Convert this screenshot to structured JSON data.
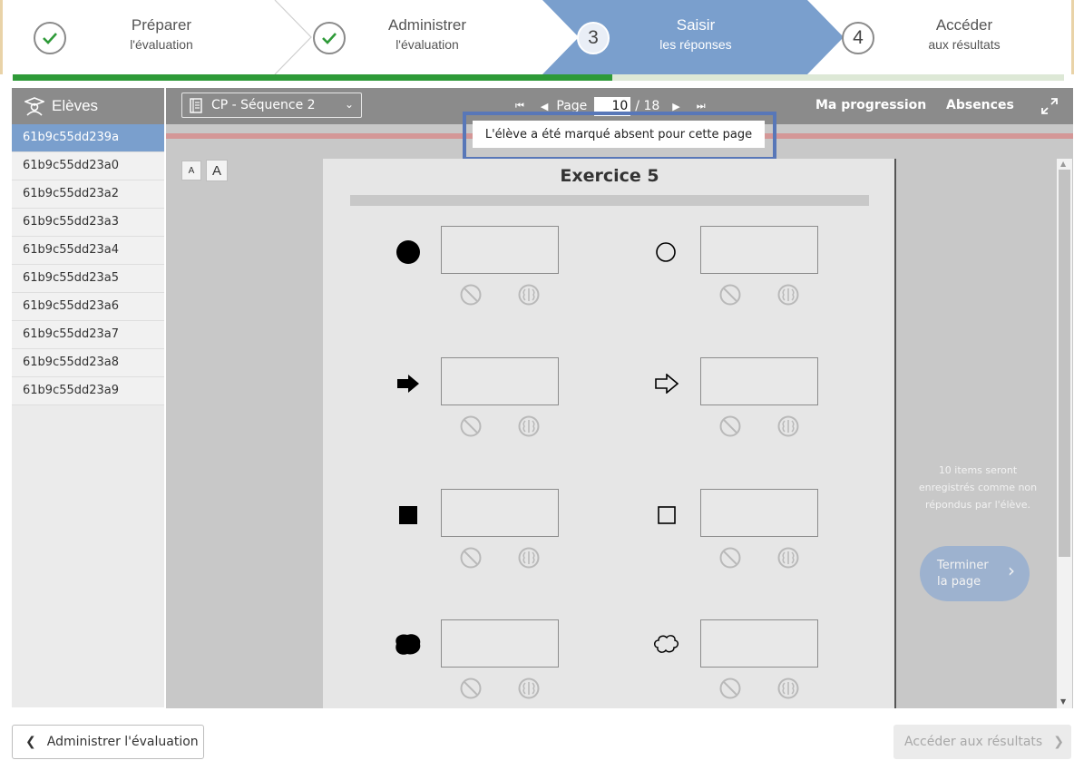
{
  "stepper": {
    "steps": [
      {
        "title": "Préparer",
        "subtitle": "l'évaluation",
        "status": "done"
      },
      {
        "title": "Administrer",
        "subtitle": "l'évaluation",
        "status": "done"
      },
      {
        "number": "3",
        "title": "Saisir",
        "subtitle": "les réponses",
        "status": "active"
      },
      {
        "number": "4",
        "title": "Accéder",
        "subtitle": "aux résultats",
        "status": "todo"
      }
    ],
    "progress_fraction": 0.57,
    "colors": {
      "active": "#7a9fcd",
      "done_check": "#2e9a38",
      "progress": "#2e9a38"
    }
  },
  "sidebar": {
    "title": "Elèves",
    "students": [
      "61b9c55dd239a",
      "61b9c55dd23a0",
      "61b9c55dd23a2",
      "61b9c55dd23a3",
      "61b9c55dd23a4",
      "61b9c55dd23a5",
      "61b9c55dd23a6",
      "61b9c55dd23a7",
      "61b9c55dd23a8",
      "61b9c55dd23a9"
    ],
    "selected_index": 0
  },
  "toolbar": {
    "sequence": "CP - Séquence 2",
    "page_label": "Page",
    "page_current": "10",
    "page_total": "/ 18",
    "progress_label": "Ma progression",
    "absences_label": "Absences"
  },
  "notice": {
    "absent": "L'élève a été marqué absent pour cette page"
  },
  "font_controls": {
    "small": "A",
    "large": "A"
  },
  "exercise": {
    "title": "Exercice 5",
    "rows": [
      {
        "left": "filled-circle-icon",
        "right": "outline-circle-icon"
      },
      {
        "left": "filled-arrow-icon",
        "right": "outline-arrow-icon"
      },
      {
        "left": "filled-square-icon",
        "right": "outline-square-icon"
      },
      {
        "left": "filled-blob-icon",
        "right": "outline-cloud-icon"
      }
    ]
  },
  "right_panel": {
    "note": "10 items seront enregistrés comme non répondus par l'élève.",
    "finish_line1": "Terminer",
    "finish_line2": "la page"
  },
  "footer": {
    "back": "Administrer l'évaluation",
    "next": "Accéder aux résultats"
  }
}
